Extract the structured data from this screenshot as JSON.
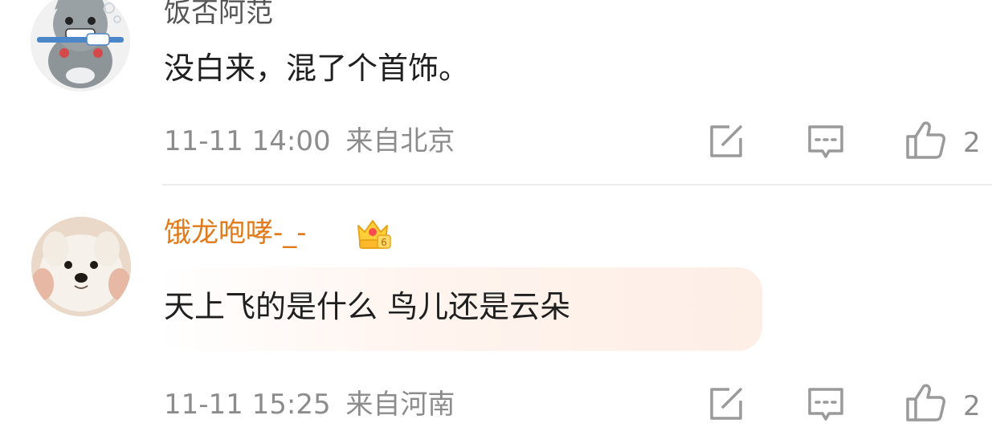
{
  "comments": [
    {
      "username": "饭否阿范",
      "text": "没白来，混了个首饰。",
      "time": "11-11 14:00",
      "location": "来自北京",
      "likes": "2",
      "avatar": "cat-avatar-icon",
      "username_color": "#555555"
    },
    {
      "username": "饿龙咆哮-_-",
      "badge_level": "6",
      "text": "天上飞的是什么 鸟儿还是云朵",
      "time": "11-11 15:25",
      "location": "来自河南",
      "likes": "2",
      "avatar": "dog-avatar-icon",
      "username_color": "#e07a1a",
      "bubble_style": "highlight"
    }
  ],
  "colors": {
    "meta_gray": "#8c8c8c",
    "icon_gray": "#9a9a9a",
    "vip_orange": "#e07a1a"
  }
}
